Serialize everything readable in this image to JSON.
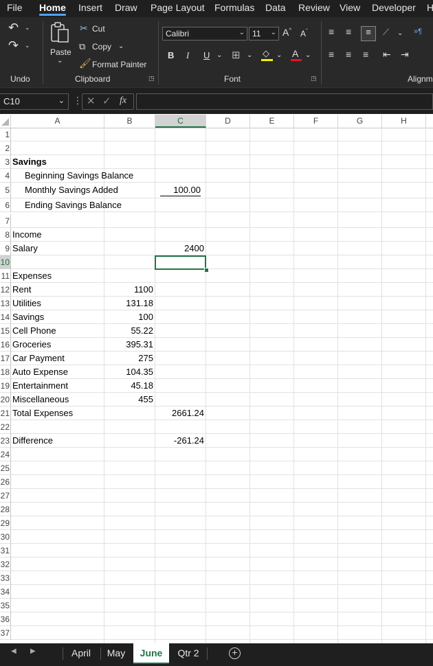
{
  "menu": {
    "tabs": [
      "File",
      "Home",
      "Insert",
      "Draw",
      "Page Layout",
      "Formulas",
      "Data",
      "Review",
      "View",
      "Developer",
      "H"
    ],
    "active": "Home"
  },
  "ribbon": {
    "undo_label": "Undo",
    "clipboard": {
      "paste": "Paste",
      "cut": "Cut",
      "copy": "Copy",
      "format_painter": "Format Painter",
      "group_label": "Clipboard"
    },
    "font": {
      "name": "Calibri",
      "size": "11",
      "group_label": "Font",
      "bold": "B",
      "italic": "I",
      "underline": "U"
    },
    "alignment_label": "Alignm"
  },
  "formula_bar": {
    "name_box": "C10",
    "fx": "fx",
    "content": ""
  },
  "columns": [
    "A",
    "B",
    "C",
    "D",
    "E",
    "F",
    "G",
    "H"
  ],
  "selected_column": "C",
  "rows": [
    "1",
    "2",
    "3",
    "4",
    "5",
    "6",
    "7",
    "8",
    "9",
    "10",
    "11",
    "12",
    "13",
    "14",
    "15",
    "16",
    "17",
    "18",
    "19",
    "20",
    "21",
    "22",
    "23",
    "24",
    "25",
    "26",
    "27",
    "28",
    "29",
    "30",
    "31",
    "32",
    "33",
    "34",
    "35",
    "36",
    "37"
  ],
  "selected_row": "10",
  "cells": {
    "a3": "Savings",
    "a4": "Beginning Savings Balance",
    "a5": "Monthly Savings Added",
    "c5": "100.00",
    "a6": "Ending Savings Balance",
    "a8": "Income",
    "a9": "Salary",
    "c9": "2400",
    "a11": "Expenses",
    "a12": "Rent",
    "b12": "1100",
    "a13": "Utilities",
    "b13": "131.18",
    "a14": "Savings",
    "b14": "100",
    "a15": "Cell Phone",
    "b15": "55.22",
    "a16": "Groceries",
    "b16": "395.31",
    "a17": "Car Payment",
    "b17": "275",
    "a18": "Auto Expense",
    "b18": "104.35",
    "a19": "Entertainment",
    "b19": "45.18",
    "a20": "Miscellaneous",
    "b20": "455",
    "a21": "Total Expenses",
    "c21": "2661.24",
    "a23": "Difference",
    "c23": "-261.24"
  },
  "sheet_tabs": [
    "April",
    "May",
    "June",
    "Qtr 2"
  ],
  "active_sheet": "June",
  "colors": {
    "accent": "#217346",
    "ribbon_bg": "#292929",
    "menubar_bg": "#1f1f1f"
  }
}
